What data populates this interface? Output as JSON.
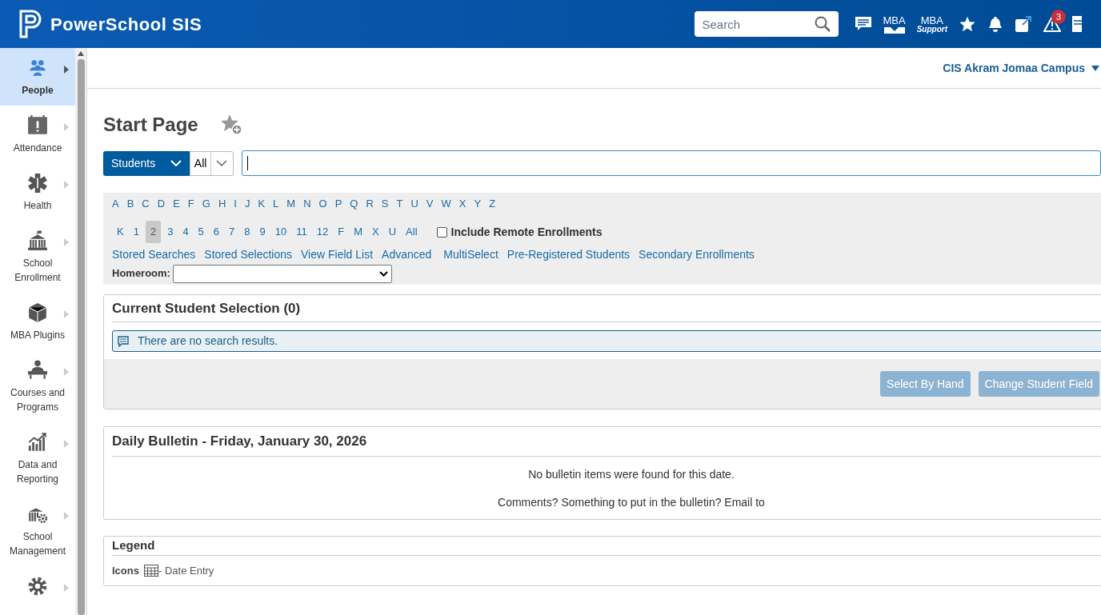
{
  "header": {
    "app_name": "PowerSchool SIS",
    "search": {
      "placeholder": "Search"
    },
    "mba_label": "MBA",
    "mba_support": [
      "MBA",
      "Support"
    ],
    "alerts_badge": "3"
  },
  "sidebar": {
    "items": [
      {
        "label": "People",
        "selected": true
      },
      {
        "label": "Attendance",
        "selected": false
      },
      {
        "label": "Health",
        "selected": false
      },
      {
        "label": "School Enrollment",
        "selected": false
      },
      {
        "label": "MBA Plugins",
        "selected": false
      },
      {
        "label": "Courses and Programs",
        "selected": false
      },
      {
        "label": "Data and Reporting",
        "selected": false
      },
      {
        "label": "School Management",
        "selected": false
      },
      {
        "selected": false
      }
    ]
  },
  "campus": "CIS Akram Jomaa Campus",
  "page_title": "Start Page",
  "search_bar": {
    "scope": "Students",
    "filter": "All"
  },
  "letters": [
    "A",
    "B",
    "C",
    "D",
    "E",
    "F",
    "G",
    "H",
    "I",
    "J",
    "K",
    "L",
    "M",
    "N",
    "O",
    "P",
    "Q",
    "R",
    "S",
    "T",
    "U",
    "V",
    "W",
    "X",
    "Y",
    "Z"
  ],
  "grades": [
    {
      "label": "K",
      "selected": false
    },
    {
      "label": "1",
      "selected": false
    },
    {
      "label": "2",
      "selected": true
    },
    {
      "label": "3",
      "selected": false
    },
    {
      "label": "4",
      "selected": false
    },
    {
      "label": "5",
      "selected": false
    },
    {
      "label": "6",
      "selected": false
    },
    {
      "label": "7",
      "selected": false
    },
    {
      "label": "8",
      "selected": false
    },
    {
      "label": "9",
      "selected": false
    },
    {
      "label": "10",
      "selected": false
    },
    {
      "label": "11",
      "selected": false
    },
    {
      "label": "12",
      "selected": false
    },
    {
      "label": "F",
      "selected": false
    },
    {
      "label": "M",
      "selected": false
    },
    {
      "label": "X",
      "selected": false
    },
    {
      "label": "U",
      "selected": false
    },
    {
      "label": "All",
      "selected": false
    }
  ],
  "include_remote": {
    "label": "Include Remote Enrollments",
    "checked": false
  },
  "links": [
    "Stored Searches",
    "Stored Selections",
    "View Field List",
    "Advanced",
    "MultiSelect",
    "Pre-Registered Students",
    "Secondary Enrollments"
  ],
  "homeroom_label": "Homeroom:",
  "selection": {
    "title": "Current Student Selection (0)",
    "message": "There are no search results.",
    "buttons": [
      {
        "label": "Select By Hand",
        "disabled": true
      },
      {
        "label": "Change Student Field",
        "disabled": true
      }
    ]
  },
  "bulletin": {
    "title": "Daily Bulletin - Friday, January 30, 2026",
    "lines": [
      "No bulletin items were found for this date.",
      "Comments? Something to put in the bulletin? Email to"
    ]
  },
  "legend": {
    "title": "Legend",
    "icons_label": "Icons",
    "entry": "- Date Entry"
  }
}
